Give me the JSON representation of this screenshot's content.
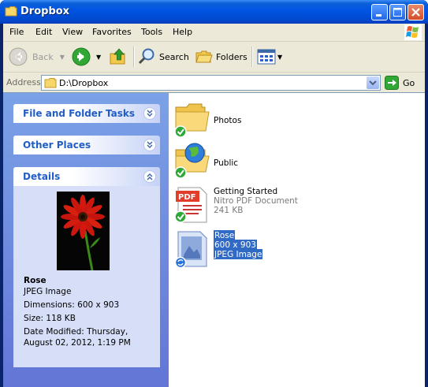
{
  "window": {
    "title": "Dropbox"
  },
  "menu": [
    "File",
    "Edit",
    "View",
    "Favorites",
    "Tools",
    "Help"
  ],
  "toolbar": {
    "back": "Back",
    "search": "Search",
    "folders": "Folders"
  },
  "address": {
    "label": "Address",
    "value": "D:\\Dropbox",
    "go": "Go"
  },
  "taskpane": {
    "file_folder_tasks": "File and Folder Tasks",
    "other_places": "Other Places",
    "details": {
      "title": "Details",
      "name": "Rose",
      "type": "JPEG Image",
      "dimensions": "Dimensions: 600 x 903",
      "size": "Size: 118 KB",
      "date1": "Date Modified: Thursday,",
      "date2": "August 02, 2012, 1:19 PM"
    }
  },
  "files": [
    {
      "name": "Photos",
      "icon": "folder-icon",
      "status": "synced"
    },
    {
      "name": "Public",
      "icon": "shared-folder-icon",
      "status": "synced"
    },
    {
      "name": "Getting Started",
      "type": "Nitro PDF Document",
      "size": "241 KB",
      "icon": "pdf-icon",
      "status": "synced"
    },
    {
      "name": "Rose",
      "dims": "600 x 903",
      "type": "JPEG Image",
      "icon": "jpeg-icon",
      "status": "syncing",
      "selected": true
    }
  ]
}
